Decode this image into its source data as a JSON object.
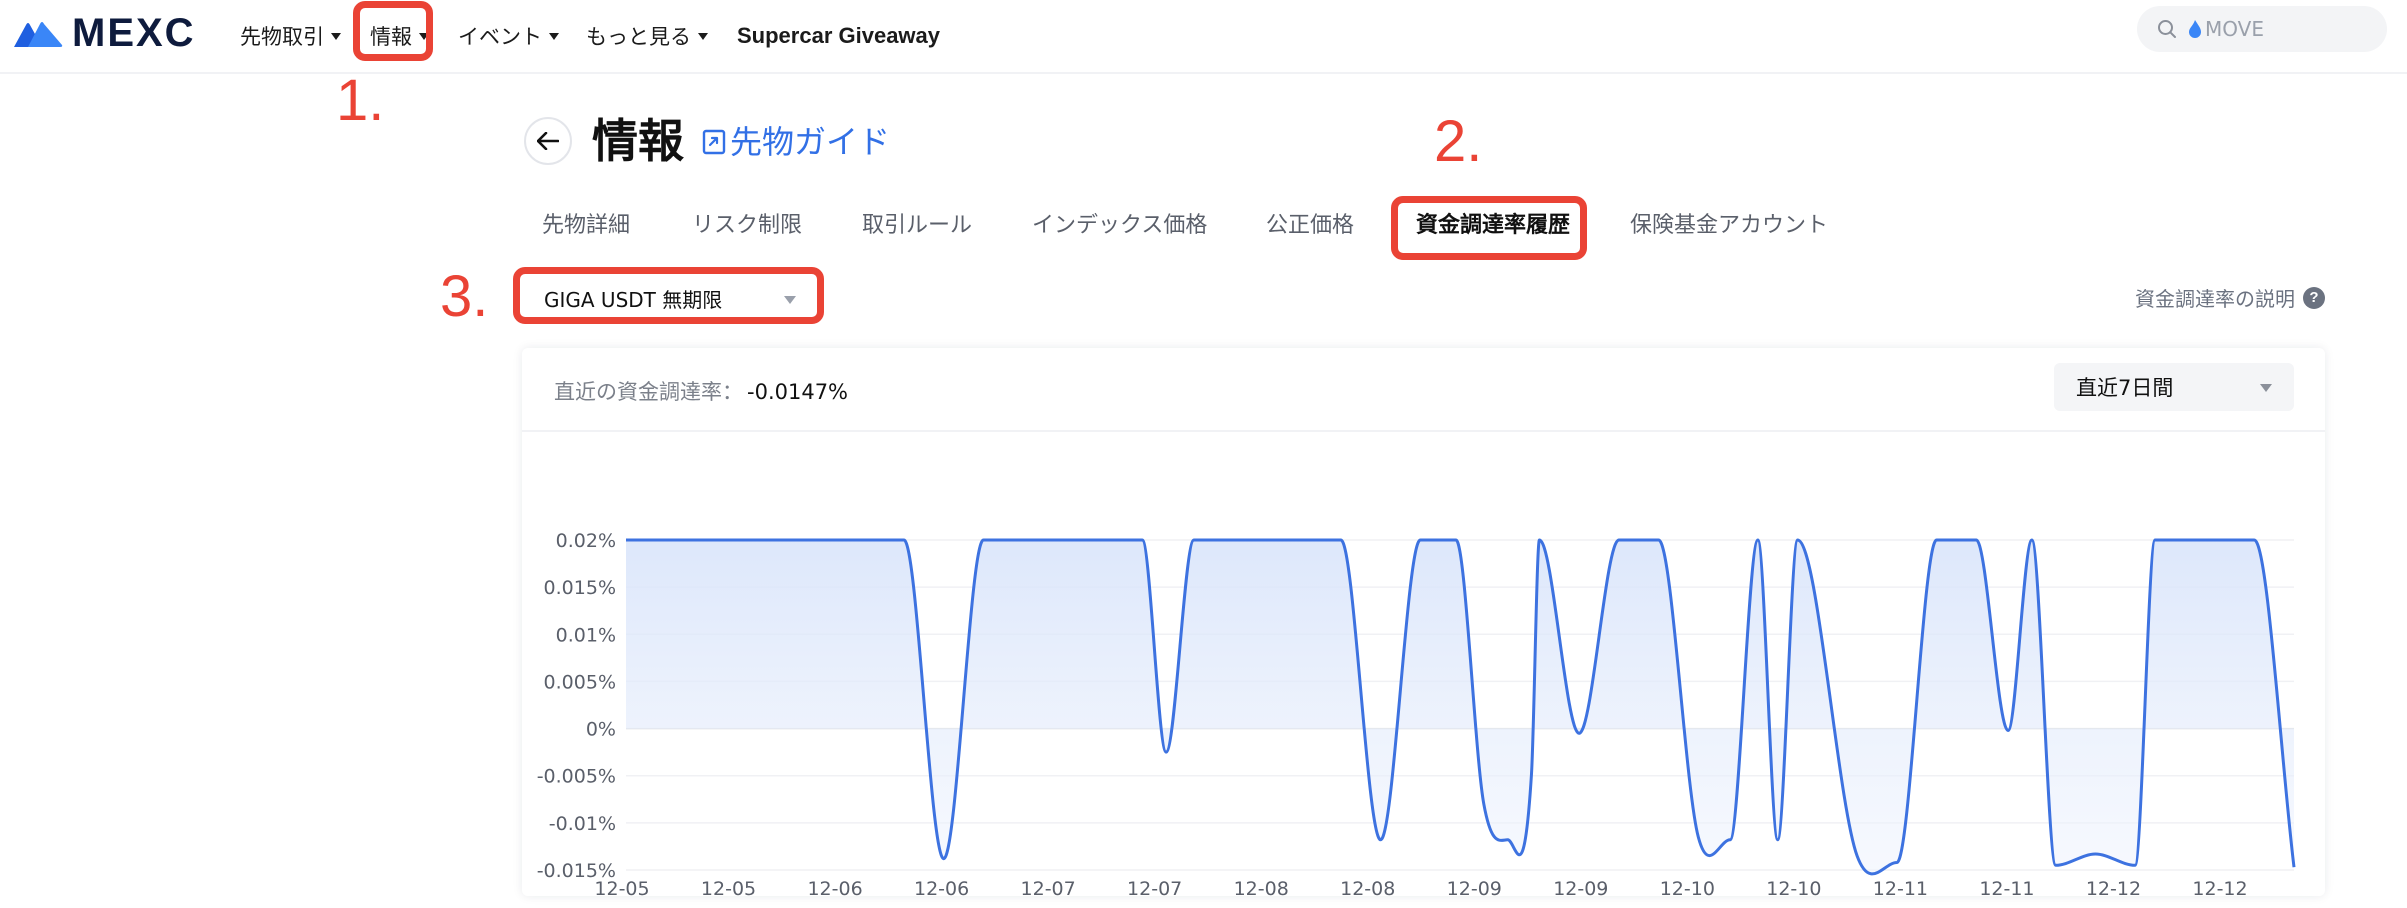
{
  "nav": {
    "brand": "MEXC",
    "items": [
      {
        "label": "先物取引",
        "caret": true
      },
      {
        "label": "情報",
        "caret": true
      },
      {
        "label": "イベント",
        "caret": true
      },
      {
        "label": "もっと見る",
        "caret": true
      },
      {
        "label": "Supercar Giveaway",
        "caret": false
      }
    ],
    "search_placeholder": "MOVE"
  },
  "annotations": {
    "one": "1.",
    "two": "2.",
    "three": "3."
  },
  "header": {
    "title": "情報",
    "guide_label": "先物ガイド"
  },
  "tabs": [
    {
      "label": "先物詳細",
      "active": false
    },
    {
      "label": "リスク制限",
      "active": false
    },
    {
      "label": "取引ルール",
      "active": false
    },
    {
      "label": "インデックス価格",
      "active": false
    },
    {
      "label": "公正価格",
      "active": false
    },
    {
      "label": "資金調達率履歴",
      "active": true
    },
    {
      "label": "保険基金アカウント",
      "active": false
    }
  ],
  "contract_select": {
    "value": "GIGA USDT 無期限"
  },
  "explain_link": {
    "label": "資金調達率の説明",
    "help_glyph": "?"
  },
  "card": {
    "recent_label": "直近の資金調達率：",
    "recent_value": "-0.0147%",
    "range_select": "直近7日間"
  },
  "colors": {
    "accent": "#3270e6",
    "line": "#3d72e0",
    "highlight": "#ea4335"
  },
  "chart_data": {
    "type": "area",
    "title": "",
    "xlabel": "",
    "ylabel": "",
    "ylim": [
      -0.015,
      0.02
    ],
    "y_ticks": [
      0.02,
      0.015,
      0.01,
      0.005,
      0,
      -0.005,
      -0.01,
      -0.015
    ],
    "y_tick_labels": [
      "0.02%",
      "0.015%",
      "0.01%",
      "0.005%",
      "0%",
      "-0.005%",
      "-0.01%",
      "-0.015%"
    ],
    "x_tick_labels": [
      "12-05",
      "12-05",
      "12-06",
      "12-06",
      "12-07",
      "12-07",
      "12-08",
      "12-08",
      "12-09",
      "12-09",
      "12-10",
      "12-10",
      "12-11",
      "12-11",
      "12-12",
      "12-12"
    ],
    "x_range": [
      0,
      42
    ],
    "grid": true,
    "series": [
      {
        "x": [
          0,
          7,
          8,
          9,
          13,
          13.6,
          14.3,
          18,
          19,
          20,
          20.9,
          21.6,
          22.2,
          22.8,
          23,
          24,
          25,
          26,
          27,
          27.8,
          28.5,
          29,
          29.5,
          31,
          32,
          33,
          34,
          34.8,
          35.4,
          36,
          37,
          38,
          38.5,
          40,
          41,
          42
        ],
        "values": [
          0.02,
          0.02,
          -0.0138,
          0.02,
          0.02,
          -0.0025,
          0.02,
          0.02,
          -0.0118,
          0.02,
          0.02,
          -0.008,
          -0.0118,
          -0.0048,
          0.02,
          -0.0005,
          0.02,
          0.02,
          -0.0115,
          -0.0118,
          0.02,
          -0.0118,
          0.02,
          -0.0135,
          -0.0142,
          0.02,
          0.02,
          -0.0002,
          0.02,
          -0.0145,
          -0.0133,
          -0.0145,
          0.02,
          0.02,
          0.02,
          -0.0147
        ]
      }
    ]
  }
}
